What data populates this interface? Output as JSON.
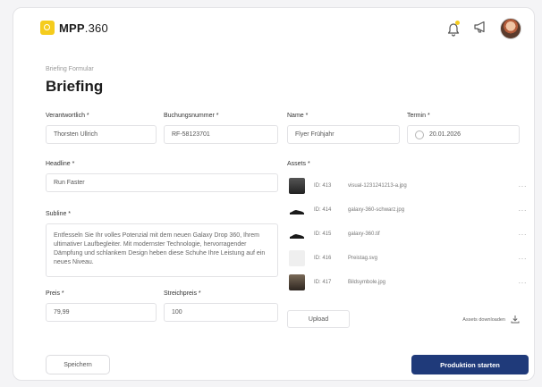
{
  "app": {
    "logo_text": "MPP",
    "logo_num": ".360"
  },
  "header": {
    "breadcrumb": "Briefing Formular",
    "title": "Briefing"
  },
  "form": {
    "verantwortlich": {
      "label": "Verantwortlich *",
      "value": "Thorsten Ullrich"
    },
    "buchungsnummer": {
      "label": "Buchungsnummer *",
      "value": "RF-58123701"
    },
    "name": {
      "label": "Name *",
      "value": "Flyer Frühjahr"
    },
    "termin": {
      "label": "Termin *",
      "value": "20.01.2026"
    },
    "headline": {
      "label": "Headline *",
      "value": "Run Faster"
    },
    "subline": {
      "label": "Subline *",
      "value": "Entfesseln Sie Ihr volles Potenzial mit dem neuen Galaxy Drop 360, Ihrem ultimativer Laufbegleiter. Mit modernster Technologie, hervorragender Dämpfung und schlankem Design heben diese Schuhe Ihre Leistung auf ein neues Niveau."
    },
    "preis": {
      "label": "Preis *",
      "value": "79,99"
    },
    "streichpreis": {
      "label": "Streichpreis *",
      "value": "100"
    }
  },
  "assets": {
    "label": "Assets *",
    "items": [
      {
        "id": "ID: 413",
        "name": "visual-1231241213-a.jpg",
        "thumb": "#3b3b3b"
      },
      {
        "id": "ID: 414",
        "name": "galaxy-360-schwarz.jpg",
        "thumb": "#1a1a1a"
      },
      {
        "id": "ID: 415",
        "name": "galaxy-360.tif",
        "thumb": "#1a1a1a"
      },
      {
        "id": "ID: 416",
        "name": "Preistag.svg",
        "thumb": "#efefef"
      },
      {
        "id": "ID: 417",
        "name": "Bildsymbole.jpg",
        "thumb": "#6a5a4a"
      }
    ],
    "more": "···",
    "upload": "Upload",
    "download_all": "Assets downloaden"
  },
  "actions": {
    "save": "Speichern",
    "start": "Produktion starten"
  },
  "colors": {
    "accent": "#f5cc1d",
    "primary": "#1f3a7a"
  }
}
